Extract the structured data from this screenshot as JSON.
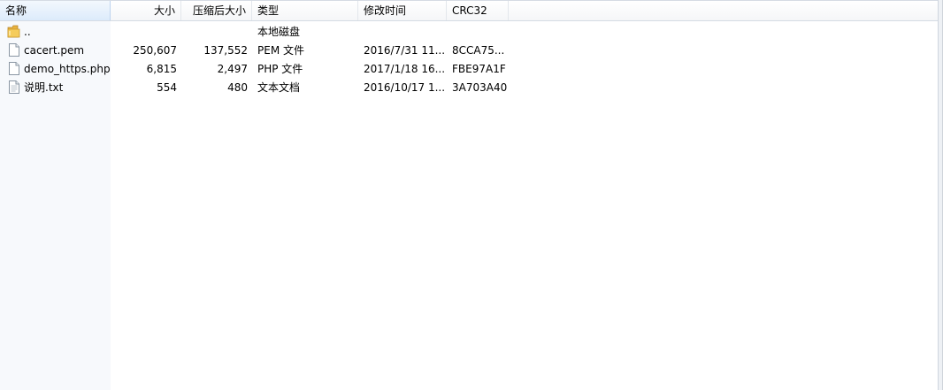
{
  "columns": {
    "name": "名称",
    "size": "大小",
    "compressed_size": "压缩后大小",
    "type": "类型",
    "modified": "修改时间",
    "crc": "CRC32"
  },
  "rows": [
    {
      "icon": "folder-up-icon",
      "name": "..",
      "size": "",
      "compressed_size": "",
      "type": "本地磁盘",
      "modified": "",
      "crc": ""
    },
    {
      "icon": "file-icon",
      "name": "cacert.pem",
      "size": "250,607",
      "compressed_size": "137,552",
      "type": "PEM 文件",
      "modified": "2016/7/31 11...",
      "crc": "8CCA75..."
    },
    {
      "icon": "file-icon",
      "name": "demo_https.php",
      "size": "6,815",
      "compressed_size": "2,497",
      "type": "PHP 文件",
      "modified": "2017/1/18 16...",
      "crc": "FBE97A1F"
    },
    {
      "icon": "text-file-icon",
      "name": "说明.txt",
      "size": "554",
      "compressed_size": "480",
      "type": "文本文档",
      "modified": "2016/10/17 1...",
      "crc": "3A703A40"
    }
  ]
}
